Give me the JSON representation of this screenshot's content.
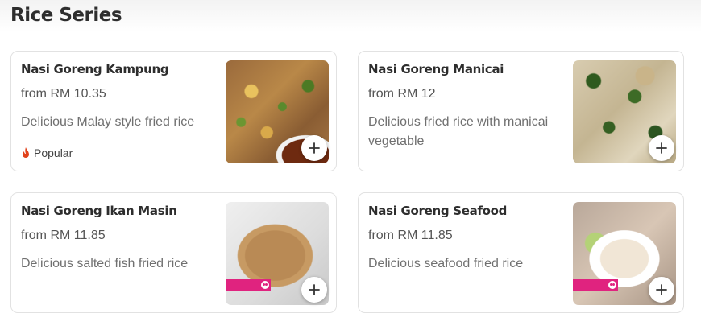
{
  "section": {
    "title": "Rice Series"
  },
  "items": [
    {
      "name": "Nasi Goreng Kampung",
      "price": "from RM 10.35",
      "description": "Delicious Malay style fried rice",
      "badge": "Popular"
    },
    {
      "name": "Nasi Goreng Manicai",
      "price": "from RM 12",
      "description": "Delicious fried rice with manicai vegetable"
    },
    {
      "name": "Nasi Goreng Ikan Masin",
      "price": "from RM 11.85",
      "description": "Delicious salted fish fried rice"
    },
    {
      "name": "Nasi Goreng Seafood",
      "price": "from RM 11.85",
      "description": "Delicious seafood fried rice"
    }
  ],
  "icons": {
    "add": "plus-icon",
    "popular": "flame-icon",
    "tag": "panda-icon"
  },
  "colors": {
    "brand_pink": "#e0237f",
    "popular_flame": "#e1421b"
  }
}
